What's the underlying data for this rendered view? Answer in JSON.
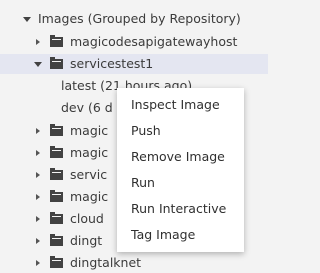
{
  "tree": {
    "group_label": "Images (Grouped by Repository)",
    "repos": [
      {
        "label": "magicodesapigatewayhost",
        "expanded": false
      },
      {
        "label": "servicestest1",
        "expanded": true,
        "selected": true
      },
      {
        "label": "magic"
      },
      {
        "label": "magic"
      },
      {
        "label": "servic"
      },
      {
        "label": "magic"
      },
      {
        "label": "cloud"
      },
      {
        "label": "dingt"
      },
      {
        "label": "dingtalknet"
      }
    ],
    "tags": [
      {
        "label": "latest (21 hours ago)"
      },
      {
        "label": "dev (6 d"
      }
    ]
  },
  "context_menu": {
    "items": [
      "Inspect Image",
      "Push",
      "Remove Image",
      "Run",
      "Run Interactive",
      "Tag Image"
    ]
  },
  "icons": {
    "expand": "chevron-right-icon",
    "collapse": "chevron-down-icon",
    "repo": "folder-icon"
  },
  "colors": {
    "background": "#f3f3f3",
    "selected_row": "#e4e6f1",
    "menu_bg": "#ffffff"
  }
}
